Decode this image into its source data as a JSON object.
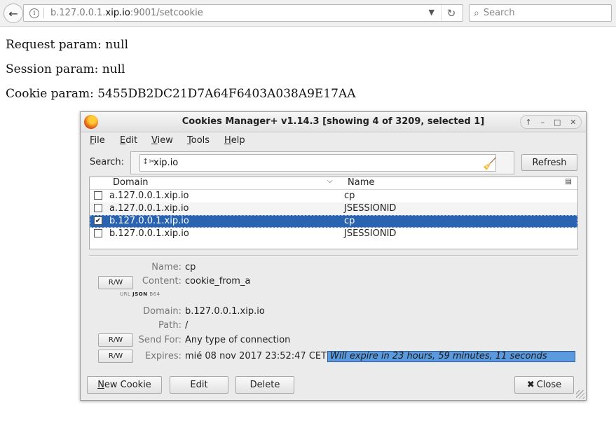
{
  "browser": {
    "url_prefix": "b.127.0.0.1.",
    "url_host": "xip.io",
    "url_suffix": ":9001/setcookie",
    "search_placeholder": "Search"
  },
  "page": {
    "request_param": "Request param: null",
    "session_param": "Session param: null",
    "cookie_param": "Cookie param: 5455DB2DC21D7A64F6403A038A9E17AA"
  },
  "dialog": {
    "title": "Cookies Manager+ v1.14.3 [showing 4 of 3209, selected 1]",
    "menu": [
      {
        "label": "File",
        "key": "F",
        "rest": "ile"
      },
      {
        "label": "Edit",
        "key": "E",
        "rest": "dit"
      },
      {
        "label": "View",
        "key": "V",
        "rest": "iew"
      },
      {
        "label": "Tools",
        "key": "T",
        "rest": "ools"
      },
      {
        "label": "Help",
        "key": "H",
        "rest": "elp"
      }
    ],
    "search_label": "Search:",
    "search_value": "xip.io",
    "refresh_label": "Refresh",
    "columns": {
      "domain": "Domain",
      "name": "Name"
    },
    "rows": [
      {
        "domain": "a.127.0.0.1.xip.io",
        "name": "cp",
        "checked": false
      },
      {
        "domain": "a.127.0.0.1.xip.io",
        "name": "JSESSIONID",
        "checked": false
      },
      {
        "domain": "b.127.0.0.1.xip.io",
        "name": "cp",
        "checked": true
      },
      {
        "domain": "b.127.0.0.1.xip.io",
        "name": "JSESSIONID",
        "checked": false
      }
    ],
    "details": {
      "name_label": "Name:",
      "name_value": "cp",
      "content_label": "Content:",
      "content_value": "cookie_from_a",
      "format_options": {
        "url": "URL",
        "json": "JSON",
        "b64": "B64"
      },
      "domain_label": "Domain:",
      "domain_value": "b.127.0.0.1.xip.io",
      "path_label": "Path:",
      "path_value": "/",
      "sendfor_label": "Send For:",
      "sendfor_value": "Any type of connection",
      "expires_label": "Expires:",
      "expires_value": "mié 08 nov 2017 23:52:47 CET",
      "expires_note": "Will expire in 23 hours, 59 minutes, 11 seconds",
      "rw_label": "R/W"
    },
    "buttons": {
      "new_cookie": "New Cookie",
      "edit": "Edit",
      "delete": "Delete",
      "close": "Close"
    }
  },
  "colors": {
    "selection": "#2a64b0",
    "expire_highlight": "#5c9ae0"
  }
}
